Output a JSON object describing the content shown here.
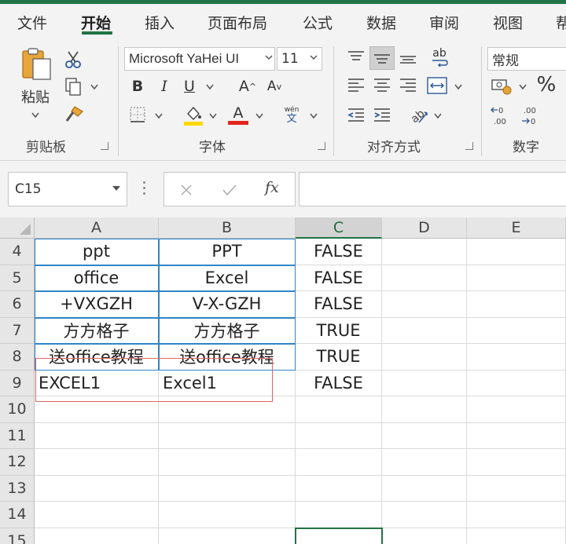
{
  "menu": {
    "tabs": [
      {
        "label": "文件",
        "active": false
      },
      {
        "label": "开始",
        "active": true
      },
      {
        "label": "插入",
        "active": false
      },
      {
        "label": "页面布局",
        "active": false
      },
      {
        "label": "公式",
        "active": false
      },
      {
        "label": "数据",
        "active": false
      },
      {
        "label": "审阅",
        "active": false
      },
      {
        "label": "视图",
        "active": false
      },
      {
        "label": "帮",
        "active": false
      }
    ]
  },
  "ribbon": {
    "clipboard": {
      "group_label": "剪贴板",
      "paste_label": "粘贴",
      "icons": [
        "paste-icon",
        "cut-icon",
        "copy-icon",
        "format-painter-icon"
      ]
    },
    "font": {
      "group_label": "字体",
      "font_name": "Microsoft YaHei UI",
      "font_size": "11",
      "bold": "B",
      "italic": "I",
      "underline": "U",
      "grow_font": "A",
      "shrink_font": "A",
      "phonetic_top": "wén",
      "phonetic_bottom": "文",
      "font_color": "A",
      "fill_color_hex": "#ffd800",
      "font_color_hex": "#e3261b"
    },
    "alignment": {
      "group_label": "对齐方式",
      "wrap_text": "ab"
    },
    "number": {
      "group_label": "数字",
      "format": "常规",
      "percent": "%",
      "inc_decimal": "←0 .00",
      "dec_decimal": ".00 →0"
    }
  },
  "formula_bar": {
    "name_box": "C15",
    "fx": "fx",
    "formula": ""
  },
  "sheet": {
    "columns": [
      "A",
      "B",
      "C",
      "D",
      "E"
    ],
    "selected_column": "C",
    "rows": [
      {
        "num": "4",
        "A": "ppt",
        "B": "PPT",
        "C": "FALSE"
      },
      {
        "num": "5",
        "A": "office",
        "B": "Excel",
        "C": "FALSE"
      },
      {
        "num": "6",
        "A": "+VXGZH",
        "B": "V-X-GZH",
        "C": "FALSE"
      },
      {
        "num": "7",
        "A": "方方格子",
        "B": "方方格子",
        "C": "TRUE"
      },
      {
        "num": "8",
        "A": "送office教程",
        "B": "送office教程",
        "C": "TRUE"
      },
      {
        "num": "9",
        "A": "EXCEL1",
        "B": "Excel1",
        "C": "FALSE"
      },
      {
        "num": "10",
        "A": "",
        "B": "",
        "C": ""
      },
      {
        "num": "11",
        "A": "",
        "B": "",
        "C": ""
      },
      {
        "num": "12",
        "A": "",
        "B": "",
        "C": ""
      },
      {
        "num": "13",
        "A": "",
        "B": "",
        "C": ""
      },
      {
        "num": "14",
        "A": "",
        "B": "",
        "C": ""
      },
      {
        "num": "15",
        "A": "",
        "B": "",
        "C": ""
      }
    ],
    "colors": {
      "accent": "#217346",
      "table_border": "#2e86c8",
      "highlight_box": "#e06666"
    }
  }
}
